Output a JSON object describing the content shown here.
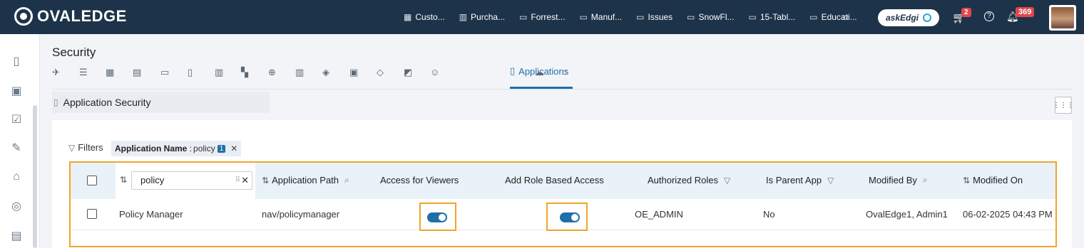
{
  "app": {
    "logo_text": "OVALEDGE"
  },
  "nav": {
    "tabs": [
      {
        "label": "Custo...",
        "icon": "table-icon"
      },
      {
        "label": "Purcha...",
        "icon": "bar-chart-icon"
      },
      {
        "label": "Forrest...",
        "icon": "folder-icon"
      },
      {
        "label": "Manuf...",
        "icon": "folder-icon"
      },
      {
        "label": "Issues",
        "icon": "folder-icon"
      },
      {
        "label": "SnowFl...",
        "icon": "folder-icon"
      },
      {
        "label": "15-Tabl...",
        "icon": "folder-icon"
      },
      {
        "label": "Educati...",
        "icon": "folder-icon"
      }
    ],
    "askedgi_label": "askEdgi",
    "cart_count": "2",
    "notification_count": "369"
  },
  "page": {
    "title": "Security",
    "active_tab": "Applications",
    "section_title": "Application Security"
  },
  "filters": {
    "label": "Filters",
    "chip_name": "Application Name",
    "chip_value": "policy",
    "chip_count": "1"
  },
  "table": {
    "search_value": "policy",
    "headers": {
      "app_path": "Application Path",
      "viewers": "Access for Viewers",
      "role_based": "Add Role Based Access",
      "roles": "Authorized Roles",
      "parent": "Is Parent App",
      "modified_by": "Modified By",
      "modified_on": "Modified On"
    },
    "rows": [
      {
        "name": "Policy Manager",
        "path": "nav/policymanager",
        "viewers_on": true,
        "role_based_on": true,
        "roles": "OE_ADMIN",
        "parent": "No",
        "modified_by": "OvalEdge1, Admin1",
        "modified_on": "06-02-2025 04:43 PM"
      }
    ]
  },
  "colors": {
    "topbar": "#1d3349",
    "accent": "#1f6fa8",
    "highlight": "#f0a52a",
    "badge": "#e0474c"
  }
}
